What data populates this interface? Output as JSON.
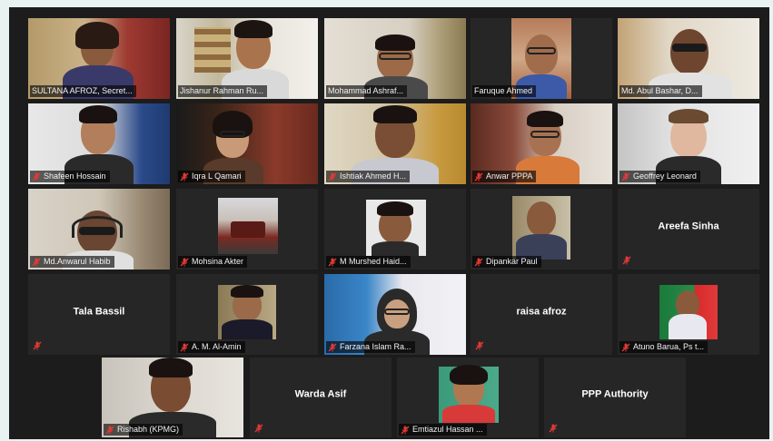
{
  "participants": [
    {
      "name": "SULTANA AFROZ, Secret..."
    },
    {
      "name": "Jishanur Rahman Ru..."
    },
    {
      "name": "Mohammad Ashraf..."
    },
    {
      "name": "Faruque Ahmed"
    },
    {
      "name": "Md. Abul Bashar, D..."
    },
    {
      "name": "Shafeen Hossain"
    },
    {
      "name": "Iqra L Qamari"
    },
    {
      "name": "Ishtiak Ahmed H..."
    },
    {
      "name": "Anwar PPPA"
    },
    {
      "name": "Geoffrey Leonard"
    },
    {
      "name": "Md.Anwarul Habib"
    },
    {
      "name": "Mohsina Akter"
    },
    {
      "name": "M Murshed Haid..."
    },
    {
      "name": "Dipankar Paul"
    },
    {
      "name": "Areefa Sinha"
    },
    {
      "name": "Tala Bassil"
    },
    {
      "name": "A. M. Al-Amin"
    },
    {
      "name": "Farzana Islam Ra..."
    },
    {
      "name": "raisa afroz"
    },
    {
      "name": "Atuno Barua, Ps t..."
    },
    {
      "name": "Rishabh (KPMG)"
    },
    {
      "name": "Warda Asif"
    },
    {
      "name": "Emtiazul Hassan ..."
    },
    {
      "name": "PPP Authority"
    }
  ],
  "colors": {
    "active_speaker_border": "#c4d92c",
    "muted_icon": "#e53935",
    "tile_background": "#262626"
  },
  "icons": {
    "muted": "mic-muted-icon"
  }
}
